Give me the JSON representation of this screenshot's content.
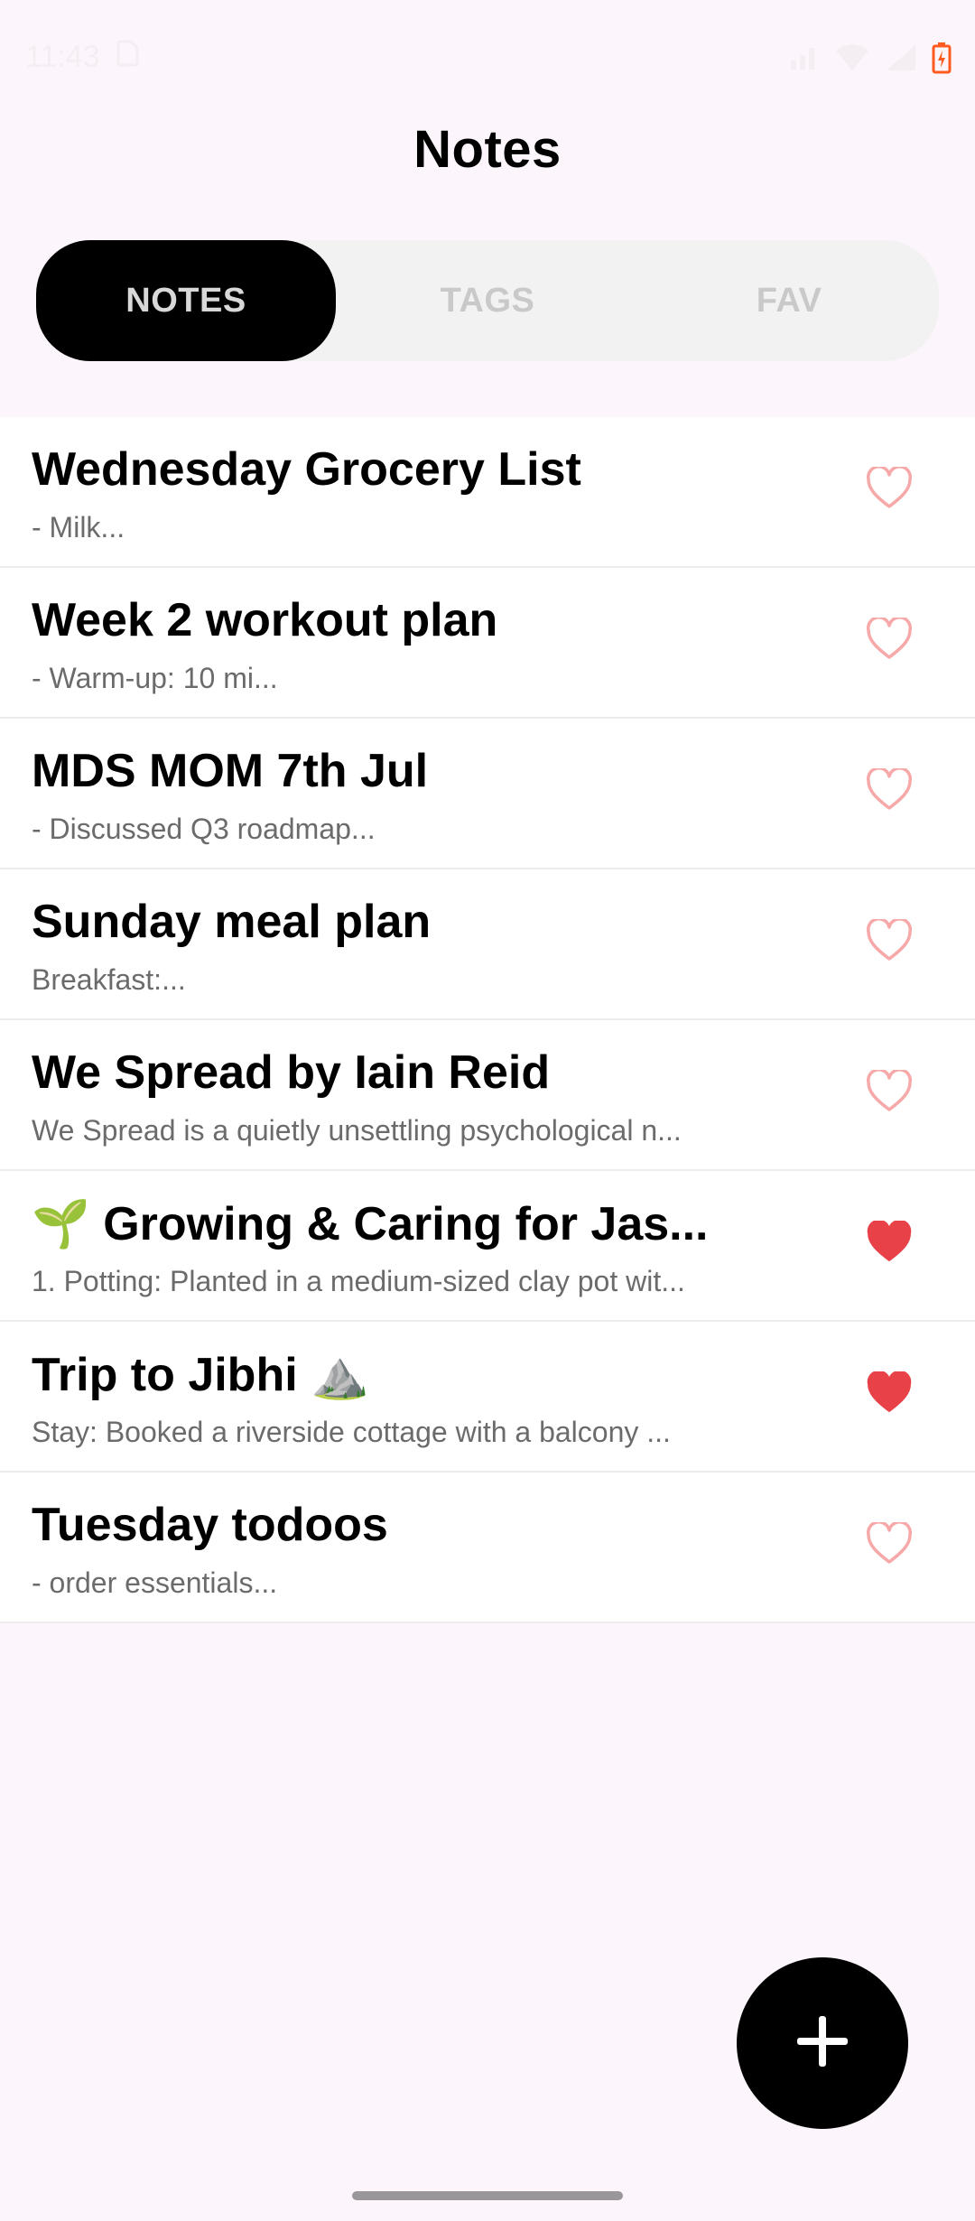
{
  "status_bar": {
    "time": "11:43",
    "icons": [
      "sim-card-icon",
      "signal-icon",
      "wifi-icon",
      "cellular-icon",
      "battery-charging-icon"
    ],
    "battery_color": "#ff5a1f"
  },
  "header": {
    "title": "Notes"
  },
  "tabs": [
    {
      "label": "NOTES",
      "active": true
    },
    {
      "label": "TAGS",
      "active": false
    },
    {
      "label": "FAV",
      "active": false
    }
  ],
  "notes": [
    {
      "title": "Wednesday Grocery List",
      "preview": "- Milk...",
      "favorite": false
    },
    {
      "title": "Week 2 workout plan",
      "preview": "- Warm-up: 10 mi...",
      "favorite": false
    },
    {
      "title": "MDS MOM 7th Jul",
      "preview": "- Discussed Q3 roadmap...",
      "favorite": false
    },
    {
      "title": "Sunday meal plan",
      "preview": "Breakfast:...",
      "favorite": false
    },
    {
      "title": "We Spread by Iain Reid",
      "preview": "We Spread is a quietly unsettling psychological n...",
      "favorite": false
    },
    {
      "title": "🌱 Growing & Caring for Jas...",
      "preview": "1. Potting: Planted in a medium-sized clay pot wit...",
      "favorite": true
    },
    {
      "title": "Trip to Jibhi ⛰️",
      "preview": "Stay: Booked a riverside cottage with a balcony ...",
      "favorite": true
    },
    {
      "title": "Tuesday todoos",
      "preview": "- order essentials...",
      "favorite": false
    }
  ],
  "colors": {
    "background": "#fdf5fc",
    "heart_outline": "#f7a8a8",
    "heart_filled": "#e84148",
    "fab": "#000000"
  },
  "fab": {
    "icon": "plus-icon"
  }
}
